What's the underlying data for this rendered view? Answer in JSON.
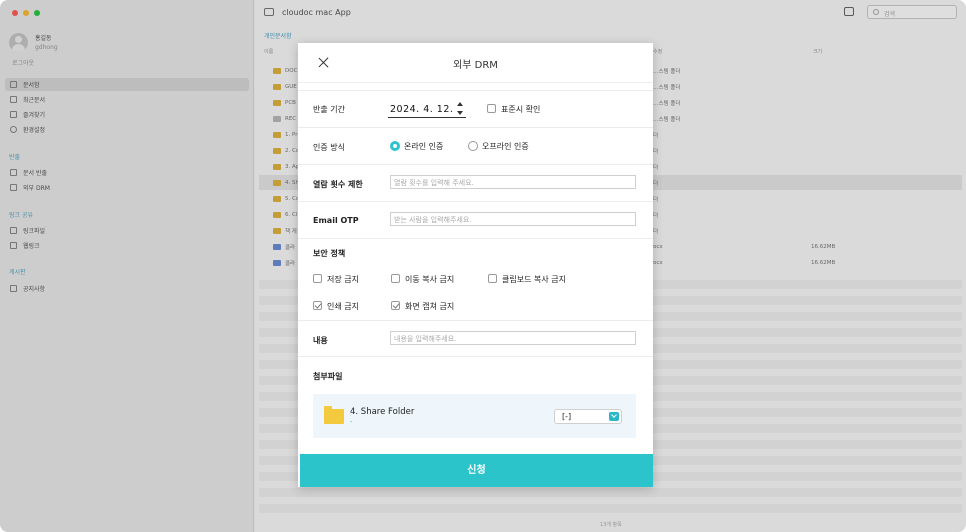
{
  "sidebar": {
    "profile_name": "홍길동",
    "profile_id": "gdhong",
    "logout": "로그아웃",
    "items": [
      {
        "label": "문서함"
      },
      {
        "label": "최근문서"
      },
      {
        "label": "즐겨찾기"
      },
      {
        "label": "환경설정"
      }
    ],
    "section_export": "반출",
    "export_items": [
      {
        "label": "문서 반출"
      },
      {
        "label": "외부 DRM"
      }
    ],
    "section_link": "링크 공유",
    "link_items": [
      {
        "label": "링크파일"
      },
      {
        "label": "웹링크"
      }
    ],
    "section_board": "게시판",
    "board_items": [
      {
        "label": "공지사항"
      }
    ]
  },
  "main": {
    "app_title": "cloudoc mac App",
    "search_placeholder": "검색",
    "breadcrumb": "개인문서함",
    "col_name": "이름",
    "col_date": "수정",
    "col_size": "크기",
    "rows": [
      {
        "name": "DOC",
        "date": "…스템 폴더",
        "size": ""
      },
      {
        "name": "GUE",
        "date": "…스템 폴더",
        "size": ""
      },
      {
        "name": "PCB",
        "date": "…스템 폴더",
        "size": ""
      },
      {
        "name": "REC",
        "date": "…스템 폴더",
        "size": ""
      },
      {
        "name": "1. Pr",
        "date": "더",
        "size": ""
      },
      {
        "name": "2. Co",
        "date": "더",
        "size": ""
      },
      {
        "name": "3. Ap",
        "date": "더",
        "size": ""
      },
      {
        "name": "4. Sh",
        "date": "더",
        "size": ""
      },
      {
        "name": "5. Co",
        "date": "더",
        "size": ""
      },
      {
        "name": "6. Cl",
        "date": "더",
        "size": ""
      },
      {
        "name": "책 게",
        "date": "더",
        "size": ""
      },
      {
        "name": "클라",
        "date": "ocx",
        "size": "16.62MB"
      },
      {
        "name": "클라",
        "date": "ocx",
        "size": "16.62MB"
      }
    ],
    "footer": "13개 항목"
  },
  "modal": {
    "title": "외부 DRM",
    "period_label": "반출 기간",
    "period_value": "2024.  4. 12.",
    "standard_time_label": "표준시 확인",
    "auth_label": "인증 방식",
    "auth_online": "온라인 인증",
    "auth_offline": "오프라인 인증",
    "view_limit_label": "열람 횟수 제한",
    "view_limit_placeholder": "열람 횟수를 입력해 주세요.",
    "otp_label": "Email OTP",
    "otp_placeholder": "받는 사람을 입력해주세요.",
    "policy_label": "보안 정책",
    "policies": [
      {
        "label": "저장 금지",
        "checked": false
      },
      {
        "label": "이동 복사 금지",
        "checked": false
      },
      {
        "label": "클립보드 복사 금지",
        "checked": false
      },
      {
        "label": "인쇄 금지",
        "checked": true
      },
      {
        "label": "화면 캡쳐 금지",
        "checked": true
      }
    ],
    "content_label": "내용",
    "content_placeholder": "내용을 입력해주세요.",
    "attach_label": "첨부파일",
    "attach_name": "4. Share Folder",
    "attach_sub": "-",
    "attach_select": "[-]",
    "submit_label": "신청"
  }
}
